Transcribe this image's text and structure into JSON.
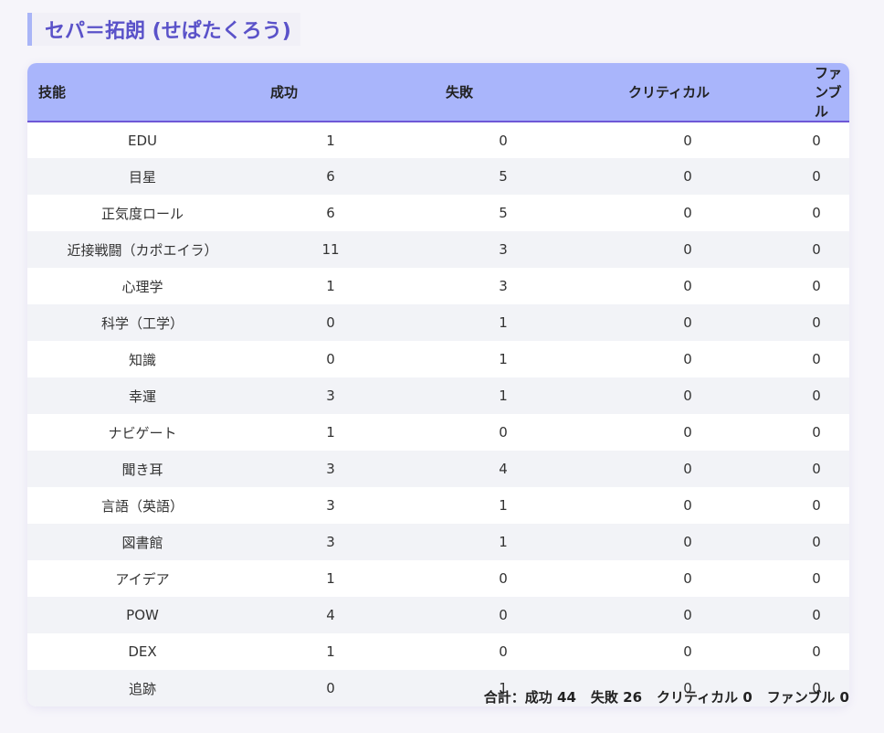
{
  "header": {
    "title": "セパ＝拓朗 (せぱたくろう)"
  },
  "table": {
    "columns": [
      "技能",
      "成功",
      "失敗",
      "クリティカル",
      "ファンブル"
    ],
    "rows": [
      [
        "EDU",
        "1",
        "0",
        "0",
        "0"
      ],
      [
        "目星",
        "6",
        "5",
        "0",
        "0"
      ],
      [
        "正気度ロール",
        "6",
        "5",
        "0",
        "0"
      ],
      [
        "近接戦闘（カポエイラ）",
        "11",
        "3",
        "0",
        "0"
      ],
      [
        "心理学",
        "1",
        "3",
        "0",
        "0"
      ],
      [
        "科学（工学）",
        "0",
        "1",
        "0",
        "0"
      ],
      [
        "知識",
        "0",
        "1",
        "0",
        "0"
      ],
      [
        "幸運",
        "3",
        "1",
        "0",
        "0"
      ],
      [
        "ナビゲート",
        "1",
        "0",
        "0",
        "0"
      ],
      [
        "聞き耳",
        "3",
        "4",
        "0",
        "0"
      ],
      [
        "言語（英語）",
        "3",
        "1",
        "0",
        "0"
      ],
      [
        "図書館",
        "3",
        "1",
        "0",
        "0"
      ],
      [
        "アイデア",
        "1",
        "0",
        "0",
        "0"
      ],
      [
        "POW",
        "4",
        "0",
        "0",
        "0"
      ],
      [
        "DEX",
        "1",
        "0",
        "0",
        "0"
      ],
      [
        "追跡",
        "0",
        "1",
        "0",
        "0"
      ]
    ]
  },
  "summary": {
    "label": "合計：",
    "success": "成功 44",
    "failure": "失敗 26",
    "critical": "クリティカル 0",
    "fumble": "ファンブル 0"
  }
}
